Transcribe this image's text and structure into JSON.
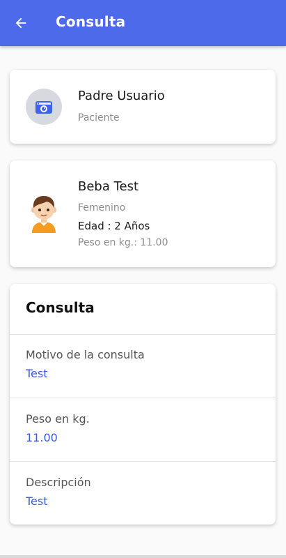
{
  "header": {
    "title": "Consulta",
    "back_icon": "arrow-left-icon",
    "color": "#4d6aeb"
  },
  "parent_card": {
    "name": "Padre Usuario",
    "role": "Paciente",
    "icon": "camera-icon"
  },
  "patient_card": {
    "name": "Beba Test",
    "gender": "Femenino",
    "age": "Edad : 2 Años",
    "weight": "Peso en kg.: 11.00",
    "avatar": "child-avatar-icon"
  },
  "consult_card": {
    "title": "Consulta",
    "fields": [
      {
        "label": "Motivo de la consulta",
        "value": "Test"
      },
      {
        "label": "Peso en kg.",
        "value": "11.00"
      },
      {
        "label": "Descripción",
        "value": "Test"
      }
    ],
    "value_color": "#3a5bd9"
  }
}
